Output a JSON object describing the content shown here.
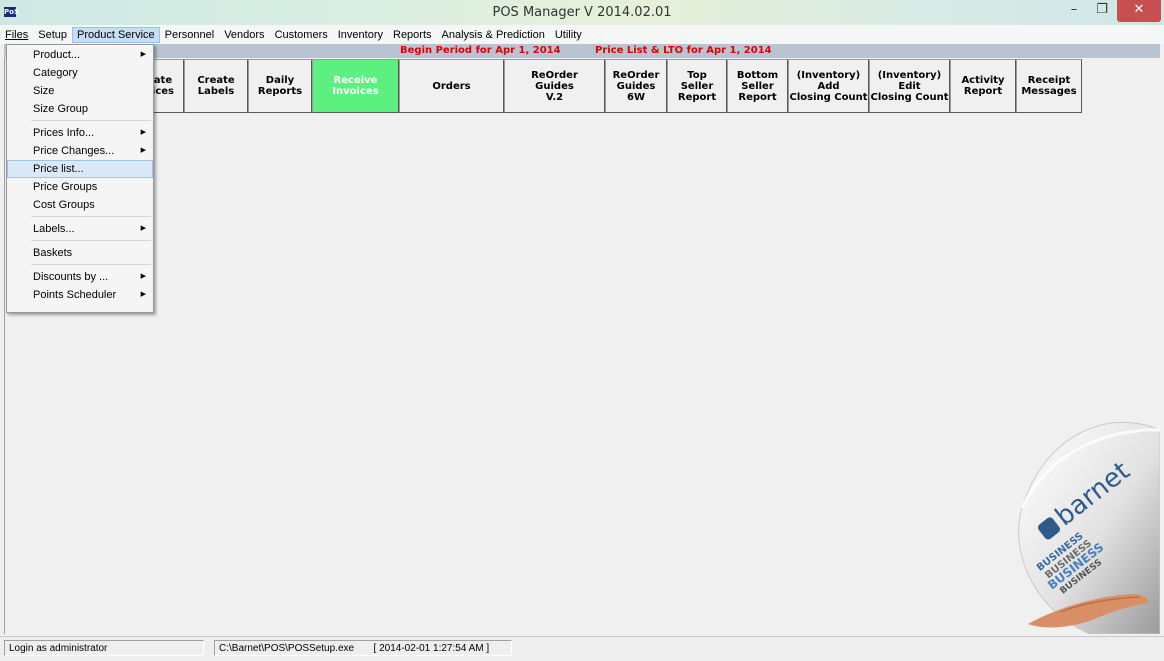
{
  "window": {
    "title": "POS Manager V 2014.02.01",
    "icon_text": "PoS",
    "minimize": "–",
    "maximize": "❐",
    "close": "✕"
  },
  "menubar": {
    "files": "Files",
    "setup": "Setup",
    "product_service": "Product Service",
    "personnel": "Personnel",
    "vendors": "Vendors",
    "customers": "Customers",
    "inventory": "Inventory",
    "reports": "Reports",
    "analysis": "Analysis & Prediction",
    "utility": "Utility"
  },
  "infobar": {
    "begin_period": "Begin Period for  Apr 1, 2014",
    "price_list": "Price List & LTO for  Apr 1, 2014",
    "color": "#e00000"
  },
  "toolbar": {
    "create_invoices": "ate\nices",
    "create_labels": "Create\nLabels",
    "daily_reports": "Daily\nReports",
    "receive_invoices": "Receive\nInvoices",
    "orders": "Orders",
    "reorder_v2": "ReOrder\nGuides\nV.2",
    "reorder_6w": "ReOrder\nGuides\n6W",
    "top_seller": "Top\nSeller\nReport",
    "bottom_seller": "Bottom\nSeller\nReport",
    "inv_add": "(Inventory)\nAdd\nClosing Count",
    "inv_edit": "(Inventory)\nEdit\nClosing Count",
    "activity": "Activity\nReport",
    "receipt": "Receipt\nMessages",
    "highlight_color": "#5cf080"
  },
  "product_menu": {
    "product": "Product...",
    "category": "Category",
    "size": "Size",
    "size_group": "Size Group",
    "prices_info": "Prices Info...",
    "price_changes": "Price Changes...",
    "price_list": "Price list...",
    "price_groups": "Price Groups",
    "cost_groups": "Cost Groups",
    "labels": "Labels...",
    "baskets": "Baskets",
    "discounts_by": "Discounts by ...",
    "points_scheduler": "Points Scheduler",
    "submenu_arrow": "▶"
  },
  "logo": {
    "brand": "barnet",
    "tag": "BUSINESS"
  },
  "statusbar": {
    "login": "Login as administrator",
    "path": "C:\\Barnet\\POS\\POSSetup.exe",
    "timestamp": "[ 2014-02-01 1:27:54 AM ]"
  }
}
